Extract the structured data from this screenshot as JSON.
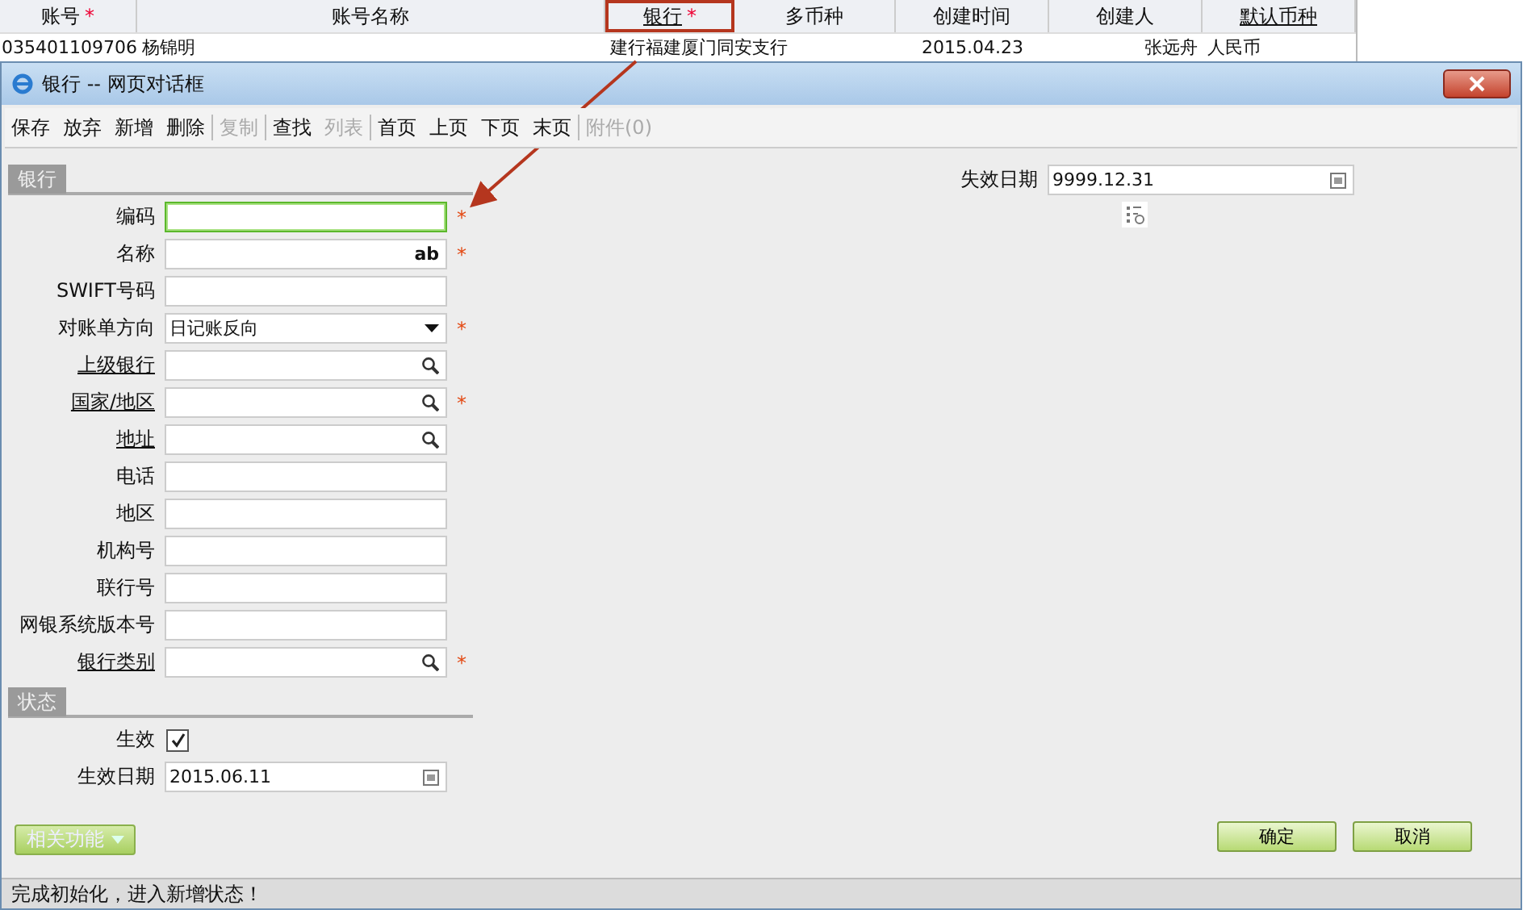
{
  "background_table": {
    "columns": [
      {
        "label": "账号",
        "mark": "*",
        "underlined": false,
        "highlighted": false
      },
      {
        "label": "账号名称",
        "underlined": false,
        "highlighted": false
      },
      {
        "label": "银行",
        "mark": "*",
        "underlined": true,
        "highlighted": true
      },
      {
        "label": "多币种",
        "underlined": false,
        "highlighted": false
      },
      {
        "label": "创建时间",
        "underlined": false,
        "highlighted": false
      },
      {
        "label": "创建人",
        "underlined": false,
        "highlighted": false
      },
      {
        "label": "默认币种",
        "underlined": true,
        "highlighted": false
      }
    ],
    "rows": [
      [
        "035401109706",
        "杨锦明",
        "建行福建厦门同安支行",
        "",
        "2015.04.23",
        "张远舟",
        "人民币"
      ]
    ]
  },
  "dialog": {
    "title": "银行 -- 网页对话框",
    "toolbar": [
      {
        "label": "保存",
        "disabled": false,
        "separator_after": false
      },
      {
        "label": "放弃",
        "disabled": false,
        "separator_after": false
      },
      {
        "label": "新增",
        "disabled": false,
        "separator_after": false
      },
      {
        "label": "删除",
        "disabled": false,
        "separator_after": true
      },
      {
        "label": "复制",
        "disabled": true,
        "separator_after": true
      },
      {
        "label": "查找",
        "disabled": false,
        "separator_after": false
      },
      {
        "label": "列表",
        "disabled": true,
        "separator_after": true
      },
      {
        "label": "首页",
        "disabled": false,
        "separator_after": false
      },
      {
        "label": "上页",
        "disabled": false,
        "separator_after": false
      },
      {
        "label": "下页",
        "disabled": false,
        "separator_after": false
      },
      {
        "label": "末页",
        "disabled": false,
        "separator_after": true
      },
      {
        "label": "附件(0)",
        "disabled": true,
        "separator_after": false
      }
    ],
    "sections": [
      {
        "title": "银行",
        "fields": [
          {
            "label": "编码",
            "kind": "text",
            "link": false,
            "mark": "*",
            "focused": true
          },
          {
            "label": "名称",
            "kind": "text",
            "link": false,
            "mark": "*",
            "focused": false,
            "suffix": "ab"
          },
          {
            "label": "SWIFT号码",
            "kind": "text",
            "link": false,
            "focused": false
          },
          {
            "label": "对账单方向",
            "kind": "dropdown",
            "link": false,
            "mark": "*",
            "focused": false,
            "value": "日记账反向"
          },
          {
            "label": "上级银行",
            "kind": "lookup",
            "link": true,
            "focused": false
          },
          {
            "label": "国家/地区",
            "kind": "lookup",
            "link": true,
            "mark": "*",
            "focused": false
          },
          {
            "label": "地址",
            "kind": "lookup",
            "link": true,
            "focused": false
          },
          {
            "label": "电话",
            "kind": "text",
            "link": false,
            "focused": false
          },
          {
            "label": "地区",
            "kind": "text",
            "link": false,
            "focused": false
          },
          {
            "label": "机构号",
            "kind": "text",
            "link": false,
            "focused": false
          },
          {
            "label": "联行号",
            "kind": "text",
            "link": false,
            "focused": false
          },
          {
            "label": "网银系统版本号",
            "kind": "text",
            "link": false,
            "focused": false
          },
          {
            "label": "银行类别",
            "kind": "lookup",
            "link": true,
            "mark": "*",
            "focused": false
          }
        ]
      },
      {
        "title": "状态",
        "fields": [
          {
            "label": "生效",
            "kind": "checkbox",
            "link": false,
            "focused": false,
            "checked": true
          },
          {
            "label": "生效日期",
            "kind": "date",
            "link": false,
            "focused": false,
            "value": "2015.06.11"
          }
        ]
      }
    ],
    "right_fields": [
      {
        "label": "失效日期",
        "kind": "date",
        "link": false,
        "focused": false,
        "value": "9999.12.31"
      }
    ],
    "related_button": {
      "label": "相关功能"
    },
    "buttons": [
      "确定",
      "取消"
    ],
    "status_bar": "完成初始化，进入新增状态！"
  }
}
